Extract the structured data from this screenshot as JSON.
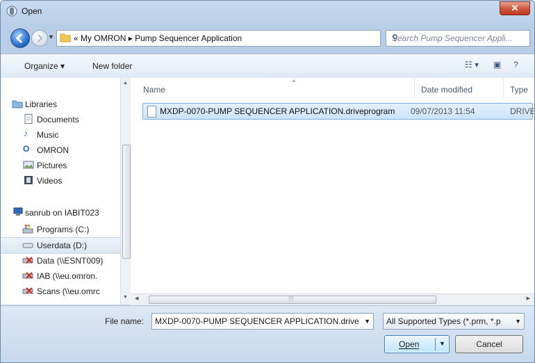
{
  "window": {
    "title": "Open"
  },
  "address": {
    "crumb_prefix": "«",
    "crumbs": [
      "My OMRON",
      "Pump Sequencer Application"
    ],
    "separator": "▸"
  },
  "search": {
    "placeholder": "Search Pump Sequencer Appli..."
  },
  "toolbar": {
    "organize_label": "Organize ▾",
    "new_folder_label": "New folder"
  },
  "nav": {
    "items": [
      {
        "label": "Libraries"
      },
      {
        "label": "Documents"
      },
      {
        "label": "Music"
      },
      {
        "label": "OMRON"
      },
      {
        "label": "Pictures"
      },
      {
        "label": "Videos"
      },
      {
        "label": "sanrub on IABIT023"
      },
      {
        "label": "Programs (C:)"
      },
      {
        "label": "Userdata (D:)"
      },
      {
        "label": "Data (\\\\ESNT009)"
      },
      {
        "label": "IAB (\\\\eu.omron."
      },
      {
        "label": "Scans (\\\\eu.omrc"
      }
    ]
  },
  "columns": {
    "name": "Name",
    "date": "Date modified",
    "type": "Type"
  },
  "files": [
    {
      "name": "MXDP-0070-PUMP SEQUENCER APPLICATION.driveprogram",
      "date": "09/07/2013 11:54",
      "type": "DRIVEF"
    }
  ],
  "footer": {
    "file_name_label": "File name:",
    "file_name_value": "MXDP-0070-PUMP SEQUENCER APPLICATION.drive",
    "file_type_value": "All Supported Types (*.prm, *.p",
    "open_label": "Open",
    "cancel_label": "Cancel"
  },
  "colors": {
    "accent": "#2a6fc7",
    "selection": "#cde4fb",
    "close": "#c0381e"
  }
}
